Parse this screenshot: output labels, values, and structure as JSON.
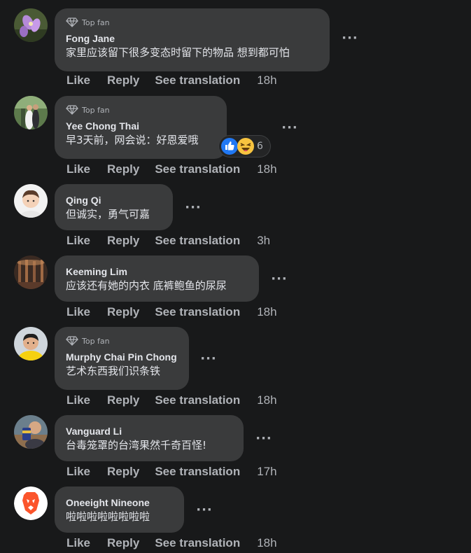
{
  "comments": [
    {
      "author": "Fong Jane",
      "top_fan_label": "Top fan",
      "text": "家里应该留下很多变态时留下的物品 想到都可怕",
      "actions": {
        "like": "Like",
        "reply": "Reply",
        "translate": "See translation"
      },
      "time": "18h",
      "avatar_icon": "purple-flower-photo"
    },
    {
      "author": "Yee Chong Thai",
      "top_fan_label": "Top fan",
      "text": "早3天前，网会说：好恩爱哦",
      "actions": {
        "like": "Like",
        "reply": "Reply",
        "translate": "See translation"
      },
      "time": "18h",
      "reactions": {
        "icons": [
          "like-reaction-icon",
          "haha-reaction-icon"
        ],
        "count": "6"
      },
      "avatar_icon": "couple-photo"
    },
    {
      "author": "Qing Qi",
      "text": "但诚实，勇气可嘉",
      "actions": {
        "like": "Like",
        "reply": "Reply",
        "translate": "See translation"
      },
      "time": "3h",
      "avatar_icon": "child-photo"
    },
    {
      "author": "Keeming Lim",
      "text": "应该还有她的内衣 底裤鲍鱼的尿尿",
      "actions": {
        "like": "Like",
        "reply": "Reply",
        "translate": "See translation"
      },
      "time": "18h",
      "avatar_icon": "dark-room-photo"
    },
    {
      "author": "Murphy Chai Pin Chong",
      "top_fan_label": "Top fan",
      "text": "艺术东西我们识条铁",
      "actions": {
        "like": "Like",
        "reply": "Reply",
        "translate": "See translation"
      },
      "time": "18h",
      "avatar_icon": "person-yellow-shirt-photo"
    },
    {
      "author": "Vanguard Li",
      "text": "台毒笼罩的台湾果然千奇百怪!",
      "actions": {
        "like": "Like",
        "reply": "Reply",
        "translate": "See translation"
      },
      "time": "17h",
      "avatar_icon": "person-cup-photo"
    },
    {
      "author": "Oneeight Nineone",
      "text": "啦啦啦啦啦啦啦啦",
      "actions": {
        "like": "Like",
        "reply": "Reply",
        "translate": "See translation"
      },
      "time": "18h",
      "avatar_icon": "brave-lion-logo"
    }
  ],
  "more_icon": "more-horizontal-icon",
  "colors": {
    "background": "#18191a",
    "bubble": "#3a3b3c",
    "text": "#e4e6eb",
    "secondary": "#b0b3b8",
    "like_blue": "#2078f4",
    "haha_yellow": "#f7c33f"
  }
}
